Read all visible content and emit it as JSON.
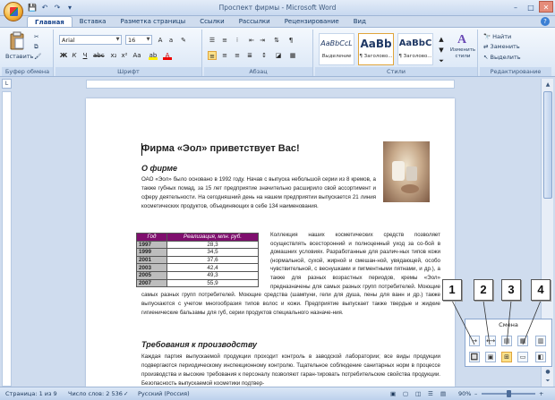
{
  "window": {
    "title": "Проспект фирмы - Microsoft Word",
    "controls": {
      "minimize": "–",
      "maximize": "□",
      "close": "✕"
    }
  },
  "quick_access": [
    "💾",
    "↶",
    "↷",
    "▾"
  ],
  "tabs": [
    {
      "label": "Главная",
      "active": true
    },
    {
      "label": "Вставка",
      "active": false
    },
    {
      "label": "Разметка страницы",
      "active": false
    },
    {
      "label": "Ссылки",
      "active": false
    },
    {
      "label": "Рассылки",
      "active": false
    },
    {
      "label": "Рецензирование",
      "active": false
    },
    {
      "label": "Вид",
      "active": false
    }
  ],
  "ribbon": {
    "clipboard": {
      "paste_label": "Вставить",
      "group_label": "Буфер обмена"
    },
    "font": {
      "name": "Arial",
      "size": "16",
      "group_label": "Шрифт",
      "bold": "Ж",
      "italic": "К",
      "underline": "Ч"
    },
    "paragraph": {
      "group_label": "Абзац"
    },
    "styles": {
      "group_label": "Стили",
      "items": [
        {
          "sample": "AaBbCcL",
          "name": "Выделение"
        },
        {
          "sample": "AaBb",
          "name": "¶ Заголово..."
        },
        {
          "sample": "AaBbC",
          "name": "¶ Заголово..."
        }
      ],
      "change_styles": "Изменить стили"
    },
    "editing": {
      "group_label": "Редактирование",
      "find": "Найти",
      "replace": "Заменить",
      "select": "Выделить"
    }
  },
  "document": {
    "heading": "Фирма «Эол» приветствует Вас!",
    "about_title": "О фирме",
    "about_text": "ОАО «Эол» было основано в 1992 году. Начав с выпуска небольшой серии из 8 кремов, а также губных помад, за 15 лет предприятие значительно расширило свой ассортимент и сферу деятельности. На сегодняшний день на нашем предприятии выпускается 21 линия косметических продуктов, объединяющих в себе 134 наименования.",
    "table": {
      "headers": [
        "Год",
        "Реализация, млн. руб."
      ],
      "rows": [
        [
          "1997",
          "28,3"
        ],
        [
          "1999",
          "34,5"
        ],
        [
          "2001",
          "37,6"
        ],
        [
          "2003",
          "42,4"
        ],
        [
          "2005",
          "49,3"
        ],
        [
          "2007",
          "55,9"
        ]
      ]
    },
    "collection_text": "Коллекция наших косметических средств позволяет осуществлять всесторонний и полноценный уход за со-бой в домашних условиях. Разработанные для различ-ных типов кожи (нормальной, сухой, жирной и смешан-ной, увядающей, особо чувствительной, с веснушками и пигментными пятнами, и др.), а также для разных возрастных периодов, кремы «Эол» предназначены для самых разных групп потребителей. Моющие средства (шампуни, гели для душа, пены для ванн и др.) также выпускаются с учетом многообразия типов волос и кожи. Предприятие выпускает также твердые и жидкие гигиенические бальзамы для губ, серии продуктов специального назначе-ния.",
    "requirements_title": "Требования к производству",
    "requirements_text": "Каждая партия выпускаемой продукции проходит контроль в заводской лаборатории; все виды продукции подвергаются периодическому инспекционному контролю. Тщательное соблюдение санитарных норм в процессе производства и высокие требования к персоналу позволяют гаран-тировать потребительские свойства продукции. Безопасность выпускаемой косметики подтвер-"
  },
  "tag_popup": {
    "title": "Смена",
    "icons": [
      "→",
      "🔲",
      "⟷",
      "▣",
      "▤",
      "⊞",
      "▦",
      "▭",
      "▥",
      "◧"
    ]
  },
  "callouts": [
    "1",
    "2",
    "3",
    "4"
  ],
  "status": {
    "page": "Страница: 1 из 9",
    "words": "Число слов: 2 536",
    "language": "Русский (Россия)",
    "zoom": "90%",
    "zoom_minus": "–",
    "zoom_plus": "+"
  }
}
